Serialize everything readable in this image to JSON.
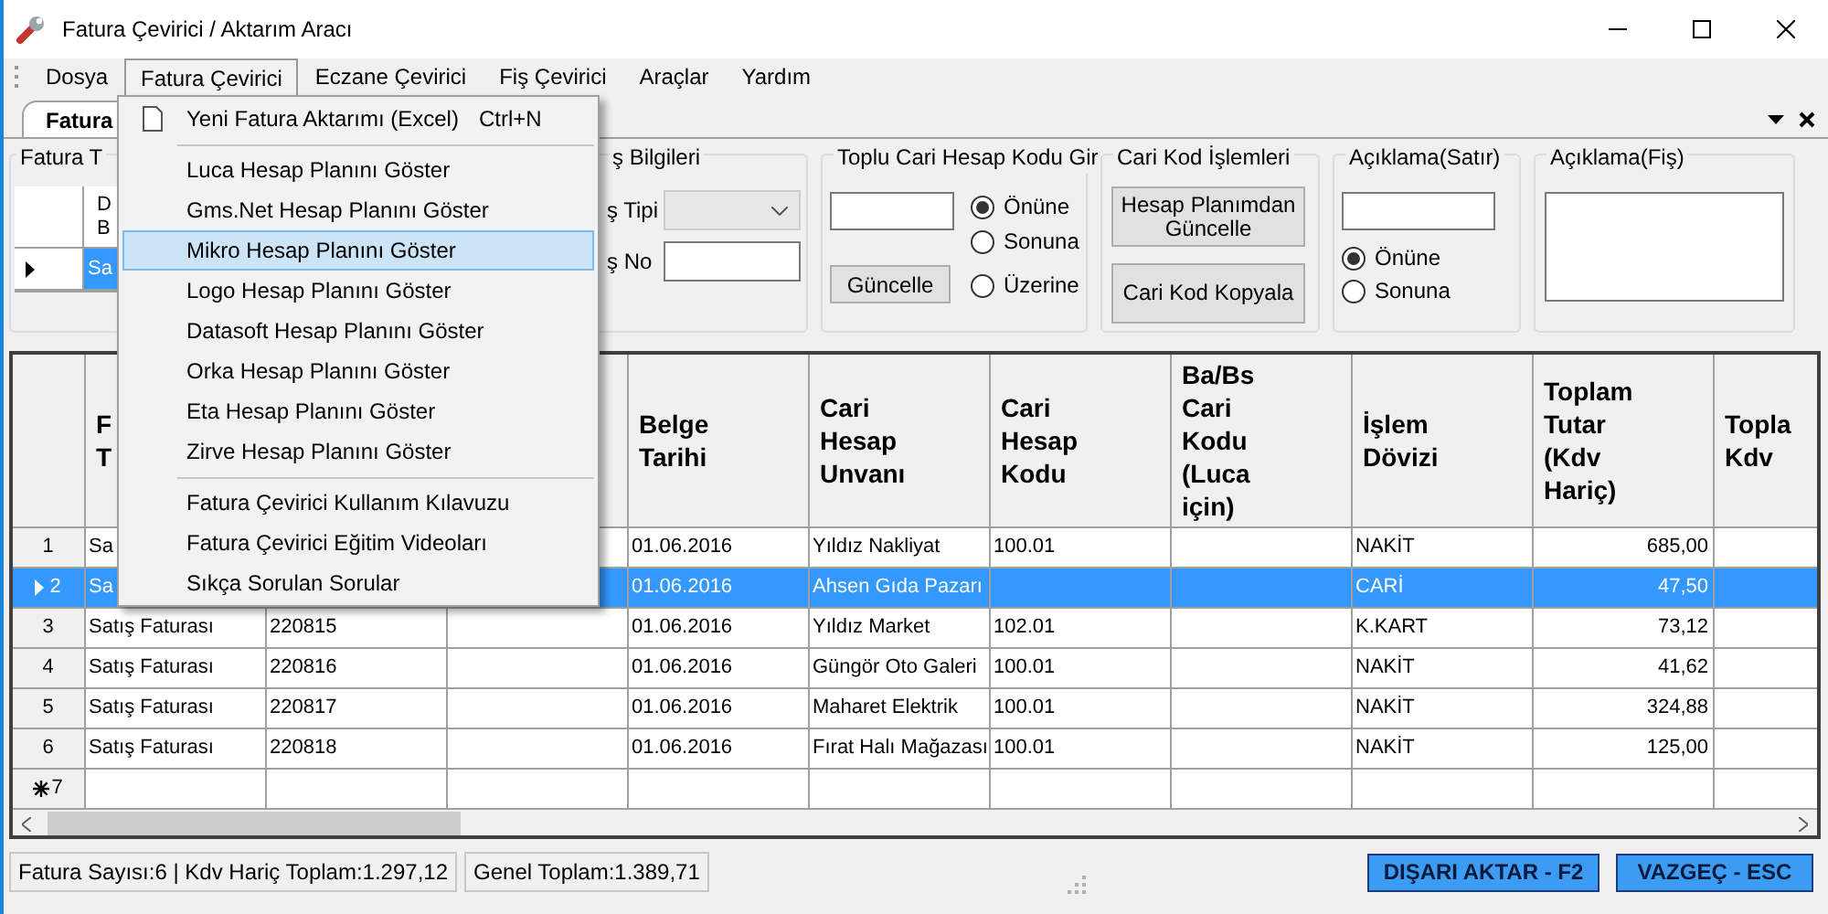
{
  "window": {
    "title": "Fatura Çevirici / Aktarım Aracı"
  },
  "menu_bar": [
    {
      "label": "Dosya",
      "selected": false
    },
    {
      "label": "Fatura Çevirici",
      "selected": true
    },
    {
      "label": "Eczane Çevirici",
      "selected": false
    },
    {
      "label": "Fiş Çevirici",
      "selected": false
    },
    {
      "label": "Araçlar",
      "selected": false
    },
    {
      "label": "Yardım",
      "selected": false
    }
  ],
  "open_menu": {
    "items": [
      {
        "kind": "item",
        "label": "Yeni Fatura Aktarımı (Excel)",
        "shortcut": "Ctrl+N",
        "selected": false
      },
      {
        "kind": "separator"
      },
      {
        "kind": "item",
        "label": "Luca Hesap Planını Göster",
        "selected": false
      },
      {
        "kind": "item",
        "label": "Gms.Net Hesap Planını Göster",
        "selected": false
      },
      {
        "kind": "item",
        "label": "Mikro Hesap Planını Göster",
        "selected": true
      },
      {
        "kind": "item",
        "label": "Logo Hesap Planını Göster",
        "selected": false
      },
      {
        "kind": "item",
        "label": "Datasoft Hesap Planını Göster",
        "selected": false
      },
      {
        "kind": "item",
        "label": "Orka Hesap Planını Göster",
        "selected": false
      },
      {
        "kind": "item",
        "label": "Eta Hesap Planını Göster",
        "selected": false
      },
      {
        "kind": "item",
        "label": "Zirve Hesap Planını Göster",
        "selected": false
      },
      {
        "kind": "separator"
      },
      {
        "kind": "item",
        "label": "Fatura Çevirici Kullanım Kılavuzu",
        "selected": false
      },
      {
        "kind": "item",
        "label": "Fatura Çevirici Eğitim Videoları",
        "selected": false
      },
      {
        "kind": "item",
        "label": "Sıkça Sorulan Sorular",
        "selected": false
      }
    ]
  },
  "tabs": [
    {
      "label": "Fatura",
      "selected": true
    }
  ],
  "invoice_type_group": {
    "title": "Fatura T",
    "header": "D B",
    "row_value": "Sa",
    "row_selected": true
  },
  "receipt_info_group": {
    "title": "ş Bilgileri",
    "type_label": "ş Tipi",
    "type_dropdown": {
      "disabled": true
    },
    "no_label": "ş No"
  },
  "bulk_code_group": {
    "title": "Toplu Cari Hesap Kodu Gir",
    "button": "Güncelle",
    "options": [
      {
        "label": "Önüne",
        "selected": true
      },
      {
        "label": "Sonuna",
        "selected": false
      },
      {
        "label": "Üzerine",
        "selected": false
      }
    ]
  },
  "code_ops_group": {
    "title": "Cari Kod İşlemleri",
    "buttons": [
      "Hesap Planımdan Güncelle",
      "Cari Kod Kopyala"
    ]
  },
  "line_note_group": {
    "title": "Açıklama(Satır)",
    "options": [
      {
        "label": "Önüne",
        "selected": true
      },
      {
        "label": "Sonuna",
        "selected": false
      }
    ]
  },
  "receipt_note_group": {
    "title": "Açıklama(Fiş)"
  },
  "table": {
    "columns": [
      "F T",
      null,
      null,
      "Belge Tarihi",
      "Cari Hesap Unvanı",
      "Cari Hesap Kodu",
      "Ba/Bs Cari Kodu (Luca için)",
      "İşlem Dövizi",
      "Toplam Tutar (Kdv Hariç)",
      "Topla Kdv"
    ],
    "rows": [
      {
        "number": "1",
        "selected": false,
        "cells": [
          "Sa",
          null,
          null,
          "01.06.2016",
          "Yıldız Nakliyat",
          "100.01",
          null,
          "NAKİT",
          "685,00",
          null
        ]
      },
      {
        "number": "2",
        "selected": true,
        "cells": [
          "Sa",
          null,
          null,
          "01.06.2016",
          "Ahsen Gıda Pazarı",
          null,
          null,
          "CARİ",
          "47,50",
          null
        ]
      },
      {
        "number": "3",
        "selected": false,
        "cells": [
          "Satış Faturası",
          "220815",
          null,
          "01.06.2016",
          "Yıldız Market",
          "102.01",
          null,
          "K.KART",
          "73,12",
          null
        ]
      },
      {
        "number": "4",
        "selected": false,
        "cells": [
          "Satış Faturası",
          "220816",
          null,
          "01.06.2016",
          "Güngör Oto Galeri",
          "100.01",
          null,
          "NAKİT",
          "41,62",
          null
        ]
      },
      {
        "number": "5",
        "selected": false,
        "cells": [
          "Satış Faturası",
          "220817",
          null,
          "01.06.2016",
          "Maharet Elektrik",
          "100.01",
          null,
          "NAKİT",
          "324,88",
          null
        ]
      },
      {
        "number": "6",
        "selected": false,
        "cells": [
          "Satış Faturası",
          "220818",
          null,
          "01.06.2016",
          "Fırat Halı Mağazası",
          "100.01",
          null,
          "NAKİT",
          "125,00",
          null
        ]
      }
    ],
    "new_row": {
      "number": "7"
    }
  },
  "status_bar": {
    "fields": [
      "Fatura Sayısı:6 | Kdv Hariç Toplam:1.297,12",
      "Genel Toplam:1.389,71"
    ]
  },
  "buttons": [
    "DIŞARI AKTAR - F2",
    "VAZGEÇ - ESC"
  ]
}
